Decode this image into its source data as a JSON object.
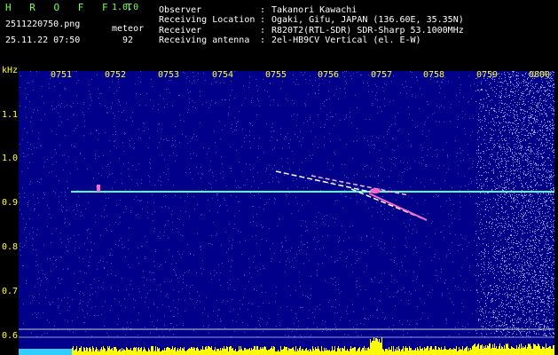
{
  "header": {
    "app_title": "H R O F F T",
    "version": "1.0.0",
    "filename": "2511220750.png",
    "datetime": "25.11.22 07:50",
    "event_label": "meteor",
    "event_count": "92",
    "info_labels": [
      "Observer",
      "Receiving Location",
      "Receiver",
      "Receiving antenna"
    ],
    "info_sep": ":",
    "info_values": [
      "Takanori Kawachi",
      "Ogaki, Gifu, JAPAN (136.60E, 35.35N)",
      "R820T2(RTL-SDR) SDR-Sharp 53.1000MHz",
      "2el-HB9CV Vertical (el. E-W)"
    ]
  },
  "spectrogram": {
    "y_unit": "kHz",
    "y_ticks": [
      "1.1",
      "1.0",
      "0.9",
      "0.8",
      "0.7",
      "0.6"
    ],
    "time_ticks": [
      "0751",
      "0752",
      "0753",
      "0754",
      "0755",
      "0756",
      "0757",
      "0758",
      "0759",
      "0800"
    ],
    "colors": {
      "background": "#00008b",
      "carrier": "#4dffd0",
      "meteor": "#ff66cc",
      "noise": "#9fb8ff",
      "level_bars": "#ffff00",
      "level_start": "#33ccff"
    }
  }
}
